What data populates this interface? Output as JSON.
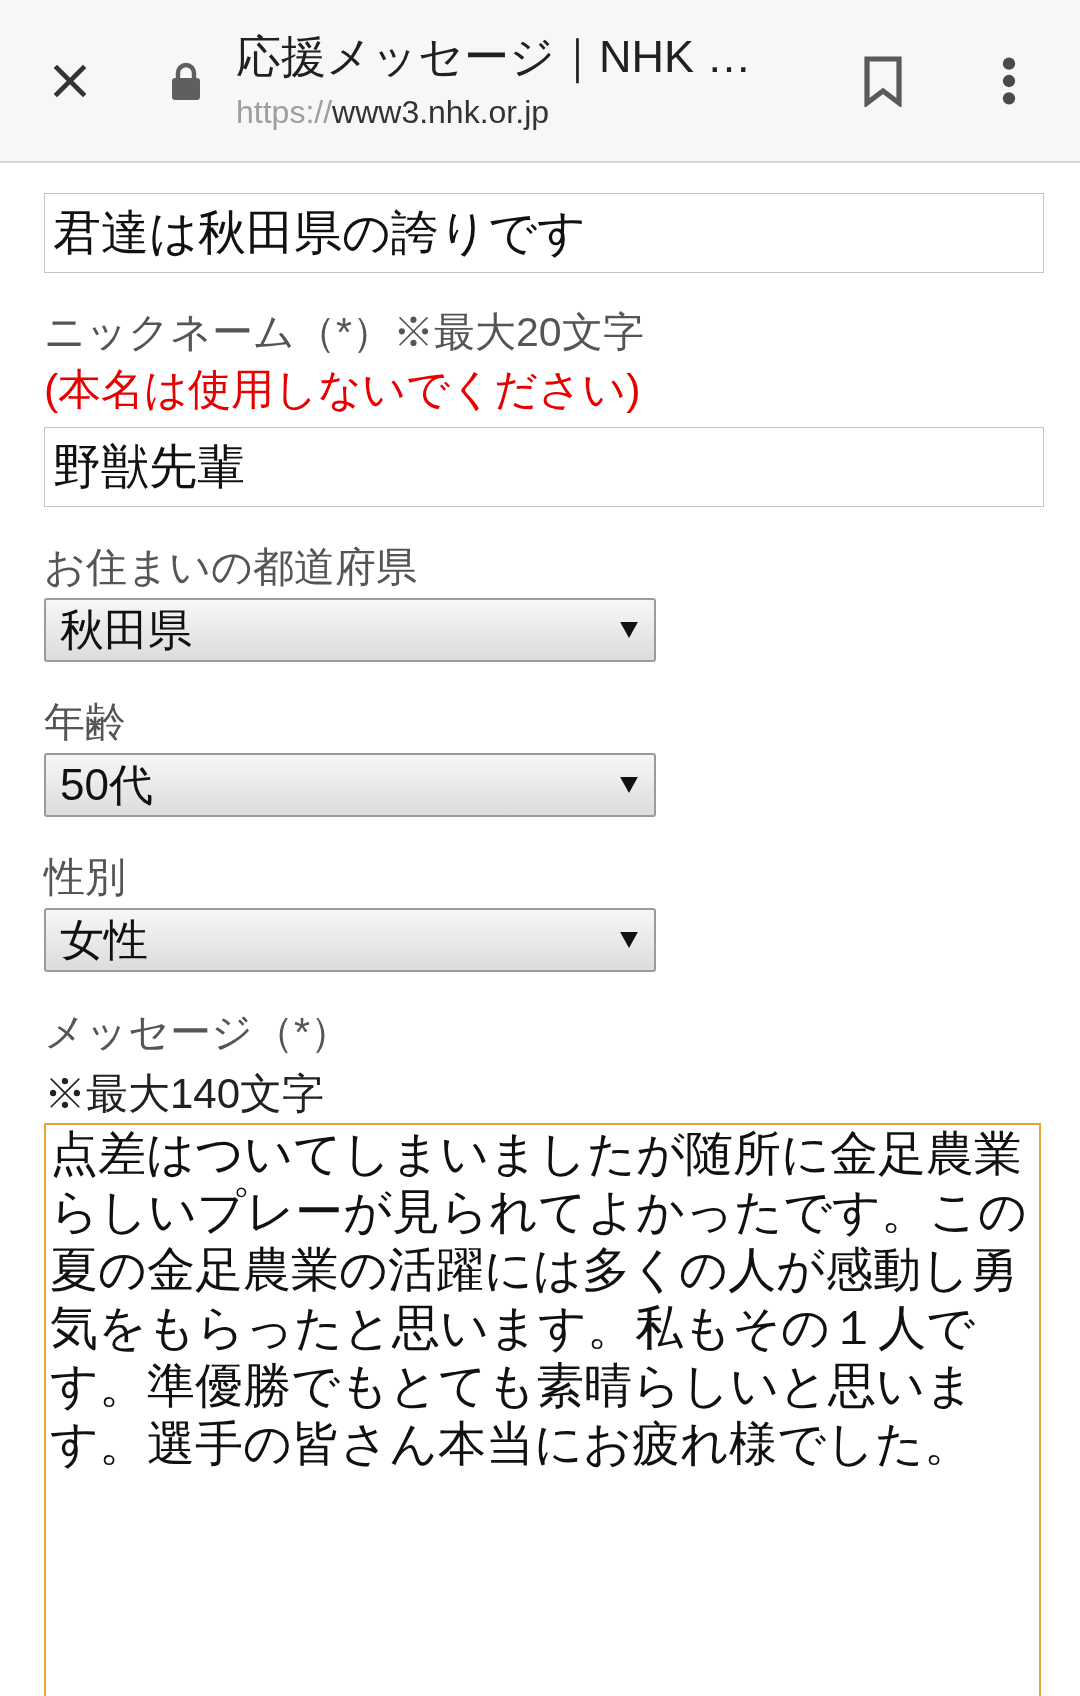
{
  "browser_bar": {
    "title": "応援メッセージ｜NHK …",
    "url": {
      "scheme": "https://",
      "host": "www3.nhk.or.jp"
    }
  },
  "form": {
    "fields": [
      {
        "kind": "text",
        "value": "君達は秋田県の誇りです"
      },
      {
        "kind": "text",
        "label": "ニックネーム（*）※最大20文字",
        "note": "(本名は使用しないでください)",
        "value": "野獣先輩"
      },
      {
        "kind": "select",
        "label": "お住まいの都道府県",
        "value": "秋田県"
      },
      {
        "kind": "select",
        "label": "年齢",
        "value": "50代"
      },
      {
        "kind": "select",
        "label": "性別",
        "value": "女性"
      },
      {
        "kind": "textarea",
        "label": "メッセージ（*）",
        "hint": "※最大140文字",
        "value": "点差はついてしまいましたが随所に金足農業らしいプレーが見られてよかったです。この夏の金足農業の活躍には多くの人が感動し勇気をもらったと思います。私もその１人です。準優勝でもとても素晴らしいと思います。選手の皆さん本当にお疲れ様でした。",
        "focused": true
      }
    ]
  }
}
